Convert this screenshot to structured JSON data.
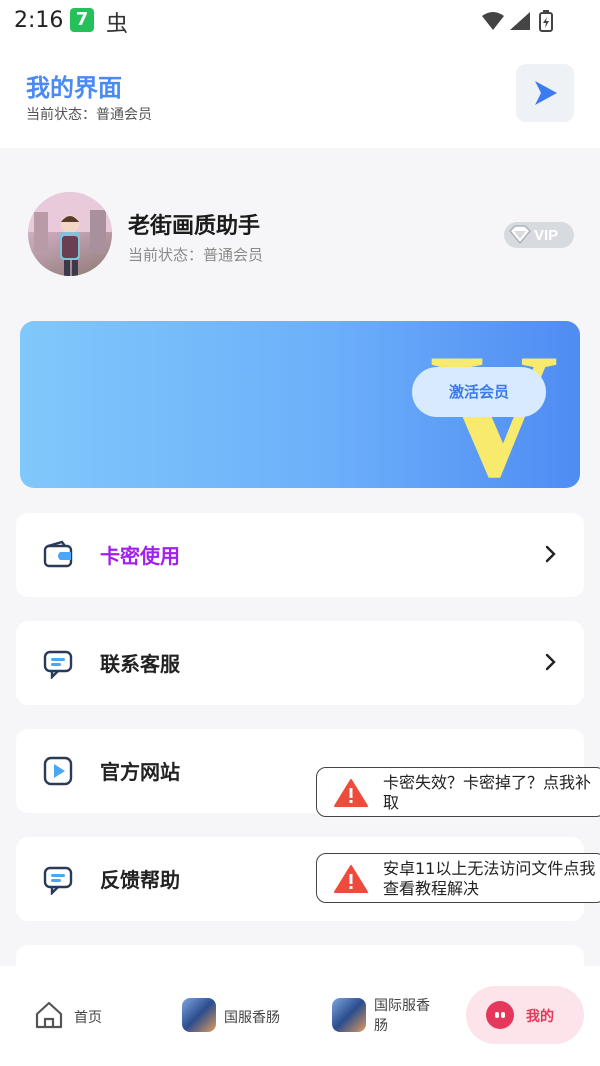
{
  "status_bar": {
    "time": "2:16",
    "app_badge": "7",
    "bug_glyph": "虫",
    "icons": [
      "wifi-icon",
      "signal-icon",
      "battery-icon"
    ]
  },
  "header": {
    "title": "我的界面",
    "subtitle": "当前状态：普通会员",
    "action_icon": "play-icon"
  },
  "profile": {
    "name": "老街画质助手",
    "status": "当前状态：普通会员",
    "badge": "VIP"
  },
  "banner": {
    "big_letter": "V",
    "button": "激活会员"
  },
  "menu": [
    {
      "label": "卡密使用",
      "icon": "wallet-icon",
      "color": "#a020f0"
    },
    {
      "label": "联系客服",
      "icon": "chat-icon",
      "color": "#222222"
    },
    {
      "label": "官方网站",
      "icon": "play-box-icon",
      "color": "#222222"
    },
    {
      "label": "反馈帮助",
      "icon": "feedback-icon",
      "color": "#222222"
    }
  ],
  "toasts": [
    {
      "text": "卡密失效？卡密掉了？点我补取"
    },
    {
      "text": "安卓11以上无法访问文件点我查看教程解决"
    }
  ],
  "tabs": [
    {
      "label": "首页",
      "icon": "home-icon"
    },
    {
      "label": "国服香肠",
      "icon": "game-icon"
    },
    {
      "label": "国际服香肠",
      "icon": "game-icon"
    },
    {
      "label": "我的",
      "icon": "me-icon"
    }
  ],
  "colors": {
    "accent_blue": "#4a8af4",
    "menu_highlight": "#a020f0",
    "me_tab_bg": "#fde4ea",
    "me_tab_icon": "#e5385c"
  }
}
